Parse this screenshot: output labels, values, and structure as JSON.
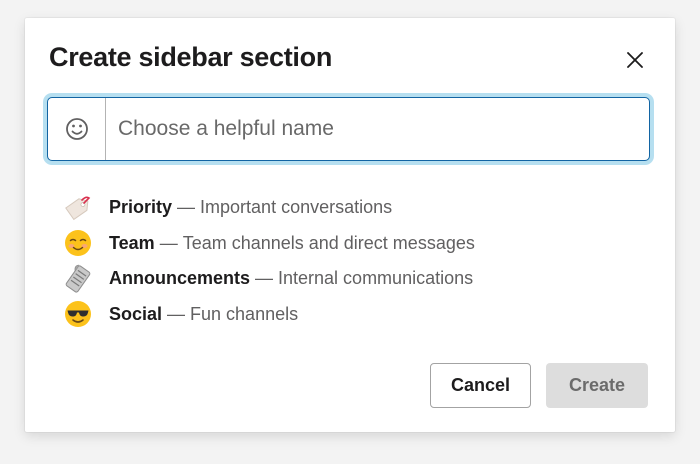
{
  "dialog": {
    "title": "Create sidebar section",
    "name_input": {
      "placeholder": "Choose a helpful name",
      "value": ""
    },
    "suggestions": [
      {
        "emoji": "label-icon",
        "label": "Priority",
        "separator": "—",
        "description": "Important conversations"
      },
      {
        "emoji": "smiling-face-icon",
        "label": "Team",
        "separator": "—",
        "description": "Team channels and direct messages"
      },
      {
        "emoji": "newspaper-icon",
        "label": "Announcements",
        "separator": "—",
        "description": "Internal communications"
      },
      {
        "emoji": "sunglasses-face-icon",
        "label": "Social",
        "separator": "—",
        "description": "Fun channels"
      }
    ],
    "buttons": {
      "cancel": "Cancel",
      "create": "Create"
    }
  },
  "colors": {
    "focus_ring": "#1d9bd1",
    "focus_border": "#1264a3",
    "create_disabled_bg": "#dddddd",
    "secondary_text": "#616061"
  }
}
